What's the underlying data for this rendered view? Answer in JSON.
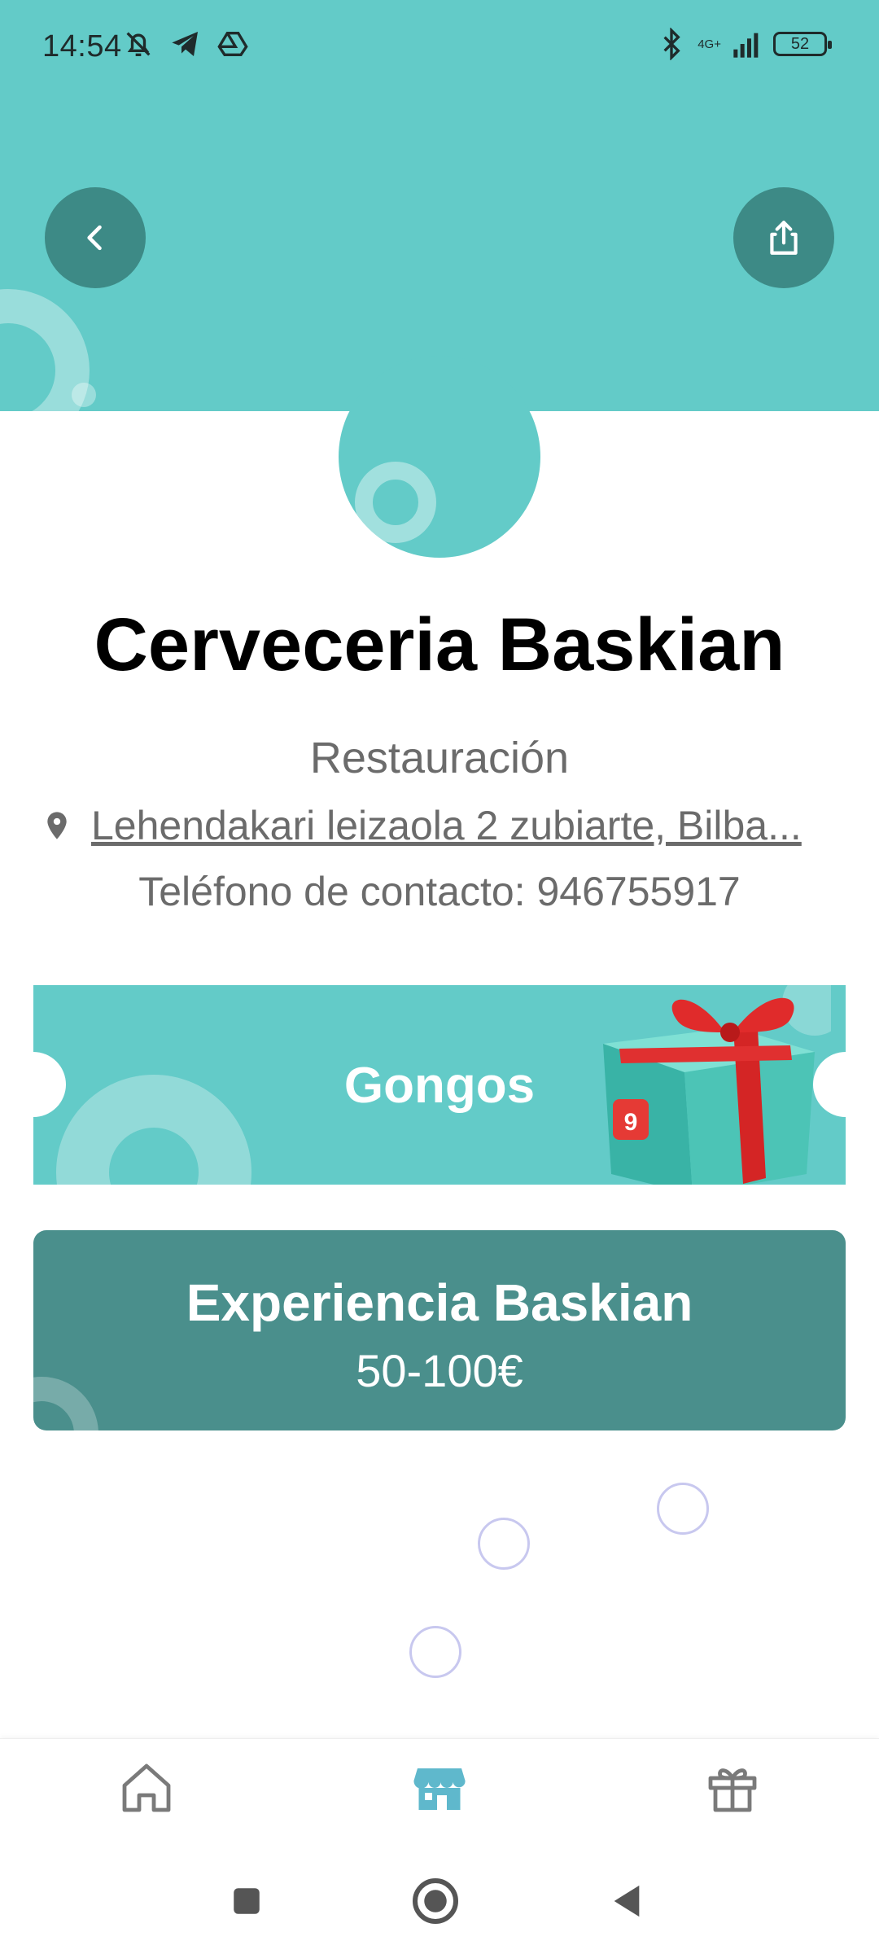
{
  "status_bar": {
    "time": "14:54",
    "network": "4G+",
    "battery": "52"
  },
  "header": {
    "back_icon": "chevron-left-icon",
    "share_icon": "share-icon",
    "accent_color": "#63cbc8",
    "button_color": "#3d8a86"
  },
  "business": {
    "name": "Cerveceria Baskian",
    "category": "Restauración",
    "address": "Lehendakari leizaola 2 zubiarte, Bilba...",
    "phone": "Teléfono de contacto: 946755917"
  },
  "cards": {
    "gongos_label": "Gongos",
    "experience_title": "Experiencia Baskian",
    "experience_price": "50-100€",
    "experience_color": "#4a8f8c"
  },
  "bottom_nav": {
    "items": [
      {
        "icon": "home-icon",
        "active": false
      },
      {
        "icon": "store-icon",
        "active": true
      },
      {
        "icon": "gift-icon",
        "active": false
      }
    ]
  },
  "system_nav": {
    "items": [
      "recents-icon",
      "home-circle-icon",
      "back-triangle-icon"
    ]
  }
}
